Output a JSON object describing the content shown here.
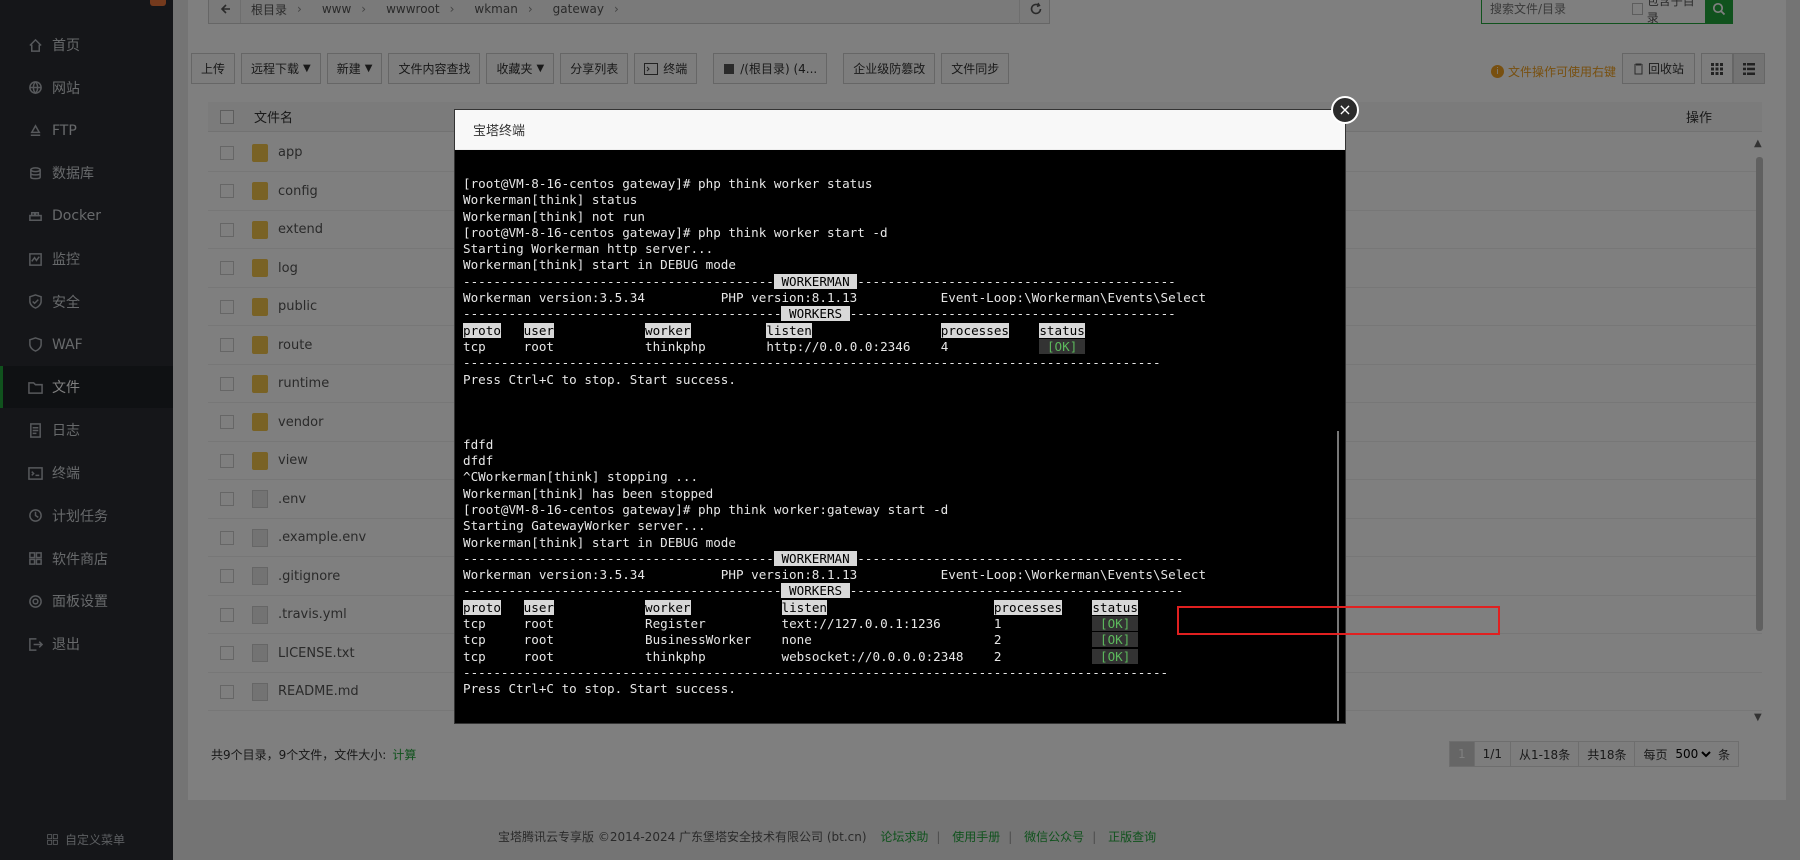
{
  "sidebar": {
    "items": [
      {
        "label": "首页",
        "icon": "home-icon"
      },
      {
        "label": "网站",
        "icon": "globe-icon"
      },
      {
        "label": "FTP",
        "icon": "ftp-icon"
      },
      {
        "label": "数据库",
        "icon": "database-icon"
      },
      {
        "label": "Docker",
        "icon": "docker-icon"
      },
      {
        "label": "监控",
        "icon": "monitor-icon"
      },
      {
        "label": "安全",
        "icon": "shield-icon"
      },
      {
        "label": "WAF",
        "icon": "waf-shield-icon"
      },
      {
        "label": "文件",
        "icon": "folder-icon",
        "active": true
      },
      {
        "label": "日志",
        "icon": "log-icon"
      },
      {
        "label": "终端",
        "icon": "terminal-icon"
      },
      {
        "label": "计划任务",
        "icon": "clock-icon"
      },
      {
        "label": "软件商店",
        "icon": "apps-icon"
      },
      {
        "label": "面板设置",
        "icon": "gear-icon"
      },
      {
        "label": "退出",
        "icon": "logout-icon"
      }
    ],
    "custom_menu": "自定义菜单",
    "active_color": "#20a53a"
  },
  "address_bar": {
    "segments": [
      "根目录",
      "www",
      "wwwroot",
      "wkman",
      "gateway"
    ]
  },
  "search": {
    "placeholder": "搜索文件/目录",
    "include_sub_label": "包含子目录"
  },
  "toolbar": {
    "upload": "上传",
    "remote_download": "远程下载",
    "new": "新建",
    "content_search": "文件内容查找",
    "favorites": "收藏夹",
    "share_list": "分享列表",
    "terminal": "终端",
    "root_dir": "/(根目录) (4...",
    "tamper_proof": "企业级防篡改",
    "file_sync": "文件同步",
    "hint": "文件操作可使用右键",
    "recycle_bin": "回收站"
  },
  "table": {
    "col_name": "文件名",
    "col_ops": "操作",
    "rows": [
      {
        "name": "app",
        "type": "folder"
      },
      {
        "name": "config",
        "type": "folder"
      },
      {
        "name": "extend",
        "type": "folder"
      },
      {
        "name": "log",
        "type": "folder"
      },
      {
        "name": "public",
        "type": "folder"
      },
      {
        "name": "route",
        "type": "folder"
      },
      {
        "name": "runtime",
        "type": "folder"
      },
      {
        "name": "vendor",
        "type": "folder"
      },
      {
        "name": "view",
        "type": "folder"
      },
      {
        "name": ".env",
        "type": "file"
      },
      {
        "name": ".example.env",
        "type": "file"
      },
      {
        "name": ".gitignore",
        "type": "file"
      },
      {
        "name": ".travis.yml",
        "type": "file"
      },
      {
        "name": "LICENSE.txt",
        "type": "file"
      },
      {
        "name": "README.md",
        "type": "file"
      }
    ]
  },
  "footer": {
    "summary": "共9个目录，9个文件，文件大小:",
    "calc": "计算",
    "page_current": "1",
    "page_total": "1/1",
    "range": "从1-18条",
    "total": "共18条",
    "per_page_label": "每页",
    "per_page_value": "500",
    "unit": "条"
  },
  "copyright": {
    "text": "宝塔腾讯云专享版 ©2014-2024 广东堡塔安全技术有限公司 (bt.cn)",
    "links": [
      "论坛求助",
      "使用手册",
      "微信公众号",
      "正版查询"
    ]
  },
  "modal": {
    "title": "宝塔终端",
    "close": "×",
    "terminal_lines": [
      {
        "t": "[root@VM-8-16-centos gateway]# php think worker status"
      },
      {
        "t": "Workerman[think] status"
      },
      {
        "t": "Workerman[think] not run"
      },
      {
        "t": "[root@VM-8-16-centos gateway]# php think worker start -d"
      },
      {
        "t": "Starting Workerman http server..."
      },
      {
        "t": "Workerman[think] start in DEBUG mode"
      },
      {
        "t": "-----------------------------------------",
        "hl": " WORKERMAN ",
        "t2": "------------------------------------------"
      },
      {
        "t": "Workerman version:3.5.34          PHP version:8.1.13           Event-Loop:\\Workerman\\Events\\Select"
      },
      {
        "t": "------------------------------------------",
        "hl": " WORKERS ",
        "t2": "-------------------------------------------"
      },
      {
        "cols": [
          "proto",
          "user",
          "worker",
          "listen",
          "processes",
          "status"
        ],
        "header": true
      },
      {
        "cols": [
          "tcp",
          "root",
          "thinkphp",
          "http://0.0.0.0:2346",
          "4",
          " [OK] "
        ]
      },
      {
        "t": "--------------------------------------------------------------------------------------------"
      },
      {
        "t": "Press Ctrl+C to stop. Start success."
      },
      {
        "t": ""
      },
      {
        "t": ""
      },
      {
        "t": ""
      },
      {
        "t": "fdfd"
      },
      {
        "t": "dfdf"
      },
      {
        "t": "^CWorkerman[think] stopping ..."
      },
      {
        "t": "Workerman[think] has been stopped"
      },
      {
        "t": "[root@VM-8-16-centos gateway]# php think worker:gateway start -d"
      },
      {
        "t": "Starting GatewayWorker server..."
      },
      {
        "t": "Workerman[think] start in DEBUG mode"
      },
      {
        "t": "-----------------------------------------",
        "hl": " WORKERMAN ",
        "t2": "-------------------------------------------"
      },
      {
        "t": "Workerman version:3.5.34          PHP version:8.1.13           Event-Loop:\\Workerman\\Events\\Select"
      },
      {
        "t": "------------------------------------------",
        "hl": " WORKERS ",
        "t2": "--------------------------------------------"
      },
      {
        "cols": [
          "proto",
          "user",
          "worker",
          "listen",
          "processes",
          "status"
        ],
        "header": true,
        "wide": true
      },
      {
        "cols": [
          "tcp",
          "root",
          "Register",
          "text://127.0.0.1:1236",
          "1",
          " [OK] "
        ],
        "wide": true
      },
      {
        "cols": [
          "tcp",
          "root",
          "BusinessWorker",
          "none",
          "2",
          " [OK] "
        ],
        "wide": true
      },
      {
        "cols": [
          "tcp",
          "root",
          "thinkphp",
          "websocket://0.0.0.0:2348",
          "2",
          " [OK] "
        ],
        "wide": true
      },
      {
        "t": "---------------------------------------------------------------------------------------------"
      },
      {
        "t": "Press Ctrl+C to stop. Start success."
      }
    ]
  }
}
